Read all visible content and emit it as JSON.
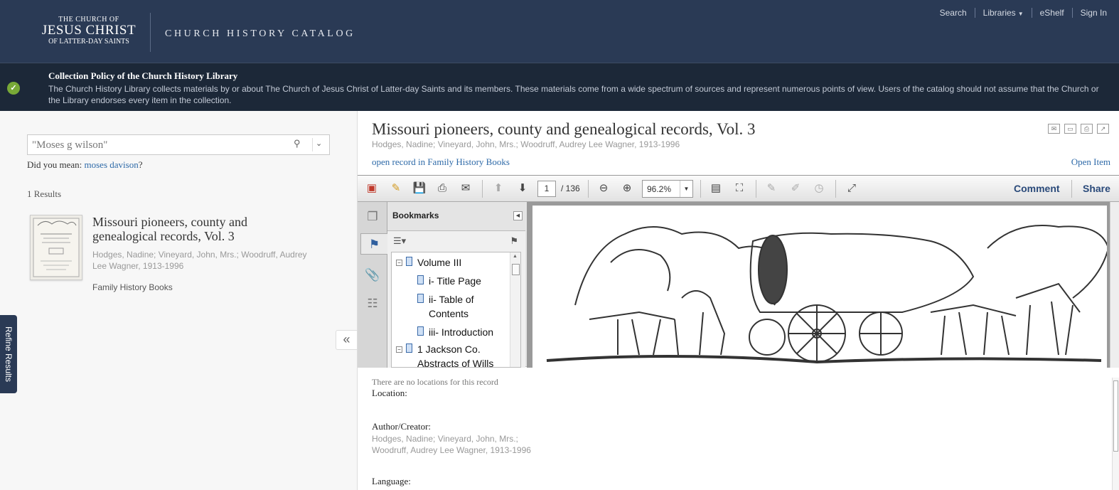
{
  "header": {
    "logo_line1": "THE CHURCH OF",
    "logo_line2": "JESUS CHRIST",
    "logo_line3": "OF LATTER-DAY SAINTS",
    "catalog_title": "CHURCH HISTORY CATALOG",
    "nav": {
      "search": "Search",
      "libraries": "Libraries",
      "eshelf": "eShelf",
      "signin": "Sign In"
    }
  },
  "notice": {
    "title": "Collection Policy of the Church History Library",
    "body": "The Church History Library collects materials by or about The Church of Jesus Christ of Latter-day Saints and its members. These materials come from a wide spectrum of sources and represent numerous points of view. Users of the catalog should not assume that the Church or the Library endorses every item in the collection."
  },
  "search": {
    "value": "\"Moses g wilson\"",
    "did_you_mean_label": "Did you mean:",
    "did_you_mean_link": "moses davison",
    "did_you_mean_suffix": "?"
  },
  "results": {
    "count": "1 Results",
    "items": [
      {
        "title": "Missouri pioneers, county and genealogical records, Vol. 3",
        "authors": "Hodges, Nadine; Vineyard, John, Mrs.; Woodruff, Audrey Lee Wagner, 1913-1996",
        "source": "Family History Books"
      }
    ]
  },
  "refine_tab": "Refine Results",
  "record": {
    "title": "Missouri pioneers, county and genealogical records, Vol. 3",
    "authors": "Hodges, Nadine; Vineyard, John, Mrs.; Woodruff, Audrey Lee Wagner, 1913-1996",
    "open_record": "open record in Family History Books",
    "open_item": "Open Item"
  },
  "viewer": {
    "page_current": "1",
    "page_total": "/ 136",
    "zoom": "96.2%",
    "comment": "Comment",
    "share": "Share",
    "bookmarks_title": "Bookmarks",
    "bookmarks": [
      {
        "label": "Volume III",
        "level": 0
      },
      {
        "label": "i- Title Page",
        "level": 1
      },
      {
        "label": "ii- Table of Contents",
        "level": 1
      },
      {
        "label": "iii- Introduction",
        "level": 1
      },
      {
        "label": "1 Jackson Co. Abstracts of Wills",
        "level": 0
      }
    ]
  },
  "details": {
    "no_locations": "There are no locations for this record",
    "location_label": "Location:",
    "author_label": "Author/Creator:",
    "author_value": "Hodges, Nadine; Vineyard, John, Mrs.; Woodruff, Audrey Lee Wagner, 1913-1996",
    "language_label": "Language:"
  },
  "colors": {
    "header_bg": "#2a3a55",
    "notice_bg": "#1c2838",
    "link": "#2e6aa8",
    "success": "#78a937"
  }
}
